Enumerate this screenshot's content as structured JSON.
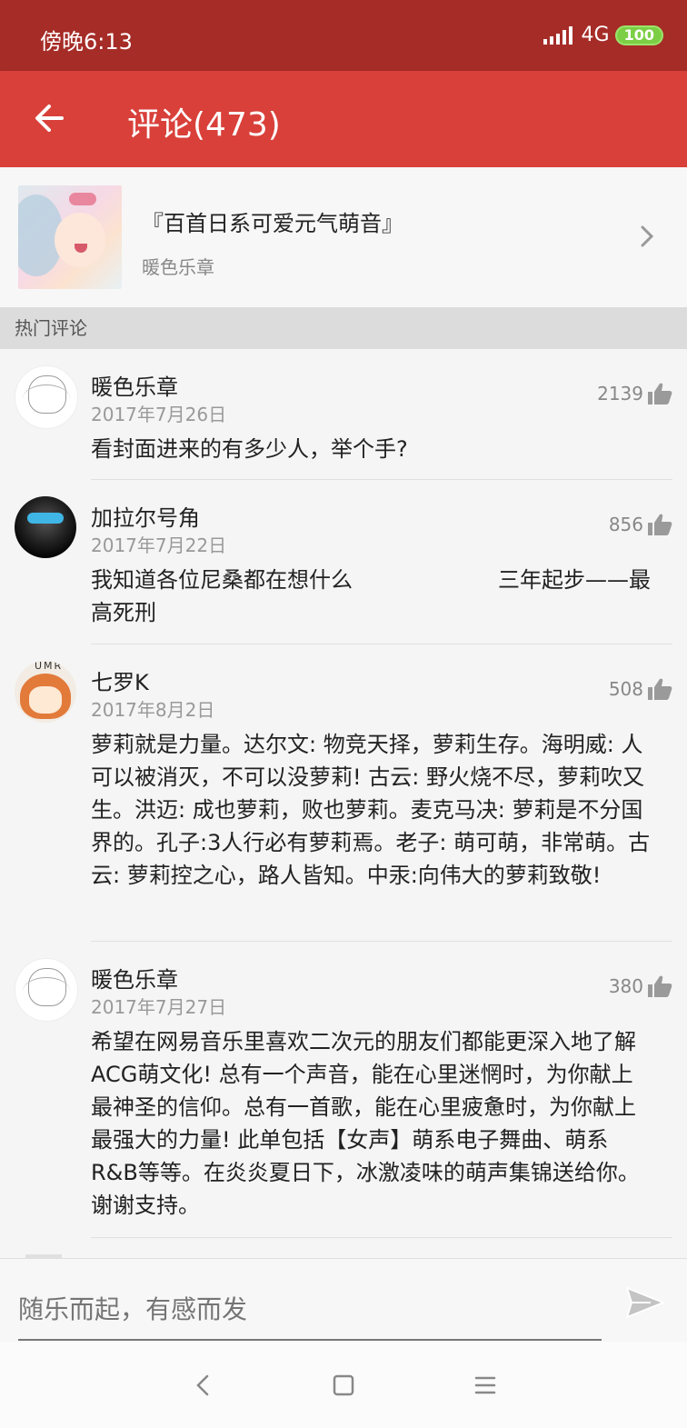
{
  "status_bar": {
    "time": "傍晚6:13",
    "network": "4G",
    "battery": "100"
  },
  "toolbar": {
    "title": "评论(473)",
    "back_icon": "arrow-left-icon"
  },
  "playlist": {
    "title": "『百首日系可爱元气萌音』",
    "author": "暖色乐章"
  },
  "section": {
    "title": "热门评论"
  },
  "comments": [
    {
      "name": "暖色乐章",
      "date": "2017年7月26日",
      "likes": "2139",
      "text": "看封面进来的有多少人，举个手?"
    },
    {
      "name": "加拉尔号角",
      "date": "2017年7月22日",
      "likes": "856",
      "text_line1": "我知道各位尼桑都在想什么",
      "text_line1b": "三年起步——最",
      "text_line2": "高死刑"
    },
    {
      "name": "七罗K",
      "date": "2017年8月2日",
      "likes": "508",
      "avatar_text": "UMR",
      "text": "萝莉就是力量。达尔文: 物竞天择，萝莉生存。海明威: 人可以被消灭，不可以没萝莉! 古云: 野火烧不尽，萝莉吹又生。洪迈: 成也萝莉，败也萝莉。麦克马决: 萝莉是不分国界的。孔子:3人行必有萝莉焉。老子: 萌可萌，非常萌。古云: 萝莉控之心，路人皆知。中汞:向伟大的萝莉致敬!"
    },
    {
      "name": "暖色乐章",
      "date": "2017年7月27日",
      "likes": "380",
      "text": "希望在网易音乐里喜欢二次元的朋友们都能更深入地了解ACG萌文化! 总有一个声音，能在心里迷惘时，为你献上最神圣的信仰。总有一首歌，能在心里疲惫时，为你献上最强大的力量! 此单包括【女声】萌系电子舞曲、萌系R&B等等。在炎炎夏日下，冰激凌味的萌声集锦送给你。谢谢支持。"
    }
  ],
  "input": {
    "placeholder": "随乐而起，有感而发"
  },
  "colors": {
    "status_bar": "#a62c27",
    "toolbar": "#d9403a",
    "battery": "#7ccf45"
  }
}
